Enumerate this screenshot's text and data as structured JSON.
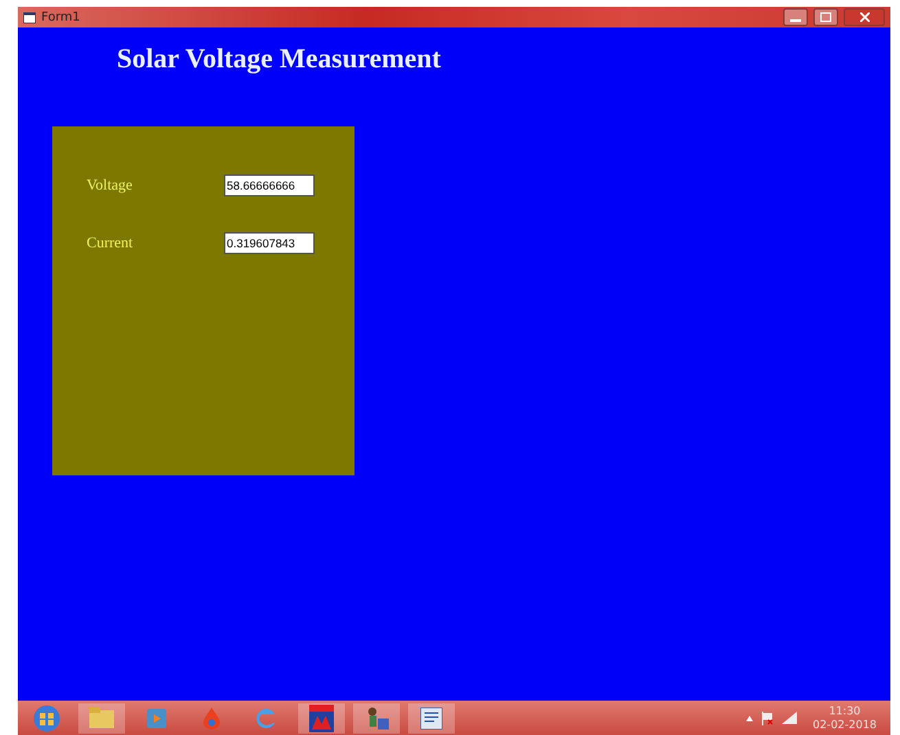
{
  "window": {
    "title": "Form1"
  },
  "heading": "Solar Voltage Measurement",
  "readings": [
    {
      "label": "Voltage",
      "value": "58.66666666"
    },
    {
      "label": "Current",
      "value": "0.319607843"
    }
  ],
  "taskbar": {
    "clock": {
      "time": "11:30",
      "date": "02-02-2018"
    }
  }
}
